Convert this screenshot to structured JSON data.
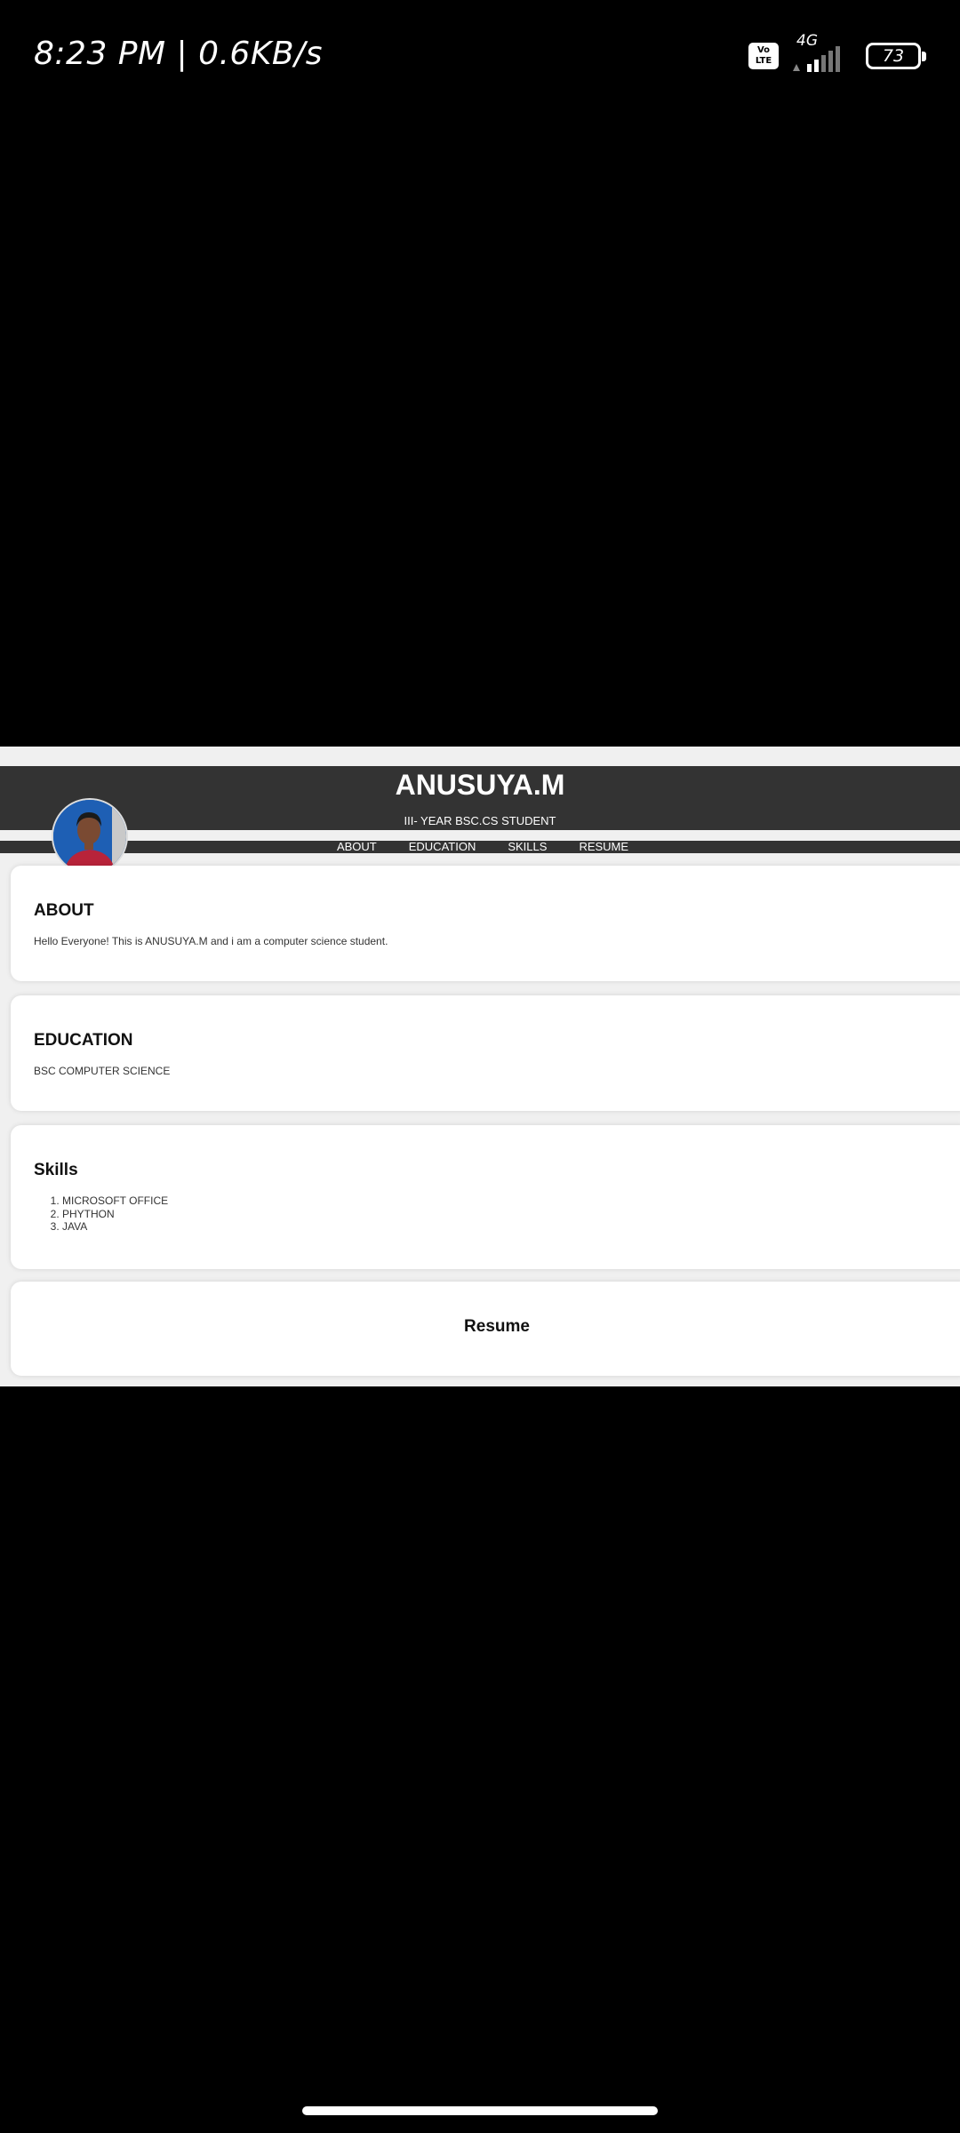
{
  "status_bar": {
    "time": "8:23 PM | 0.6KB/s",
    "volte": "Vo LTE",
    "network": "4G",
    "battery": "73",
    "battery_fraction": 0.73
  },
  "site": {
    "name": "ANUSUYA.M",
    "subtitle": "III- YEAR BSC.CS STUDENT",
    "nav": [
      "ABOUT",
      "EDUCATION",
      "SKILLS",
      "RESUME"
    ]
  },
  "about": {
    "heading": "ABOUT",
    "text": "Hello Everyone! This is ANUSUYA.M and i am a computer science student."
  },
  "education": {
    "heading": "EDUCATION",
    "text": "BSC COMPUTER SCIENCE"
  },
  "skills": {
    "heading": "Skills",
    "items": [
      "MICROSOFT OFFICE",
      "PHYTHON",
      "JAVA"
    ]
  },
  "resume": {
    "heading": "Resume"
  },
  "colors": {
    "header_bg": "#333333",
    "page_bg": "#f0f0f0",
    "card_bg": "#ffffff"
  }
}
